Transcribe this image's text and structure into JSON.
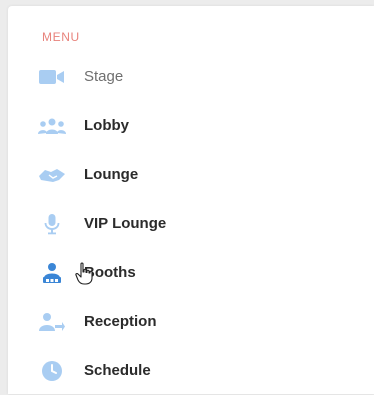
{
  "menu": {
    "heading": "MENU",
    "items": [
      {
        "label": "Stage",
        "icon": "video-camera-icon"
      },
      {
        "label": "Lobby",
        "icon": "group-icon"
      },
      {
        "label": "Lounge",
        "icon": "handshake-icon"
      },
      {
        "label": "VIP Lounge",
        "icon": "microphone-icon"
      },
      {
        "label": "Booths",
        "icon": "booth-user-icon"
      },
      {
        "label": "Reception",
        "icon": "user-arrow-icon"
      },
      {
        "label": "Schedule",
        "icon": "clock-icon"
      }
    ]
  },
  "colors": {
    "heading": "#e8837c",
    "icon_light": "#a9cdf2",
    "icon_active": "#3b86d6",
    "text": "#2b2b2b",
    "text_muted": "#6f6f6f"
  }
}
